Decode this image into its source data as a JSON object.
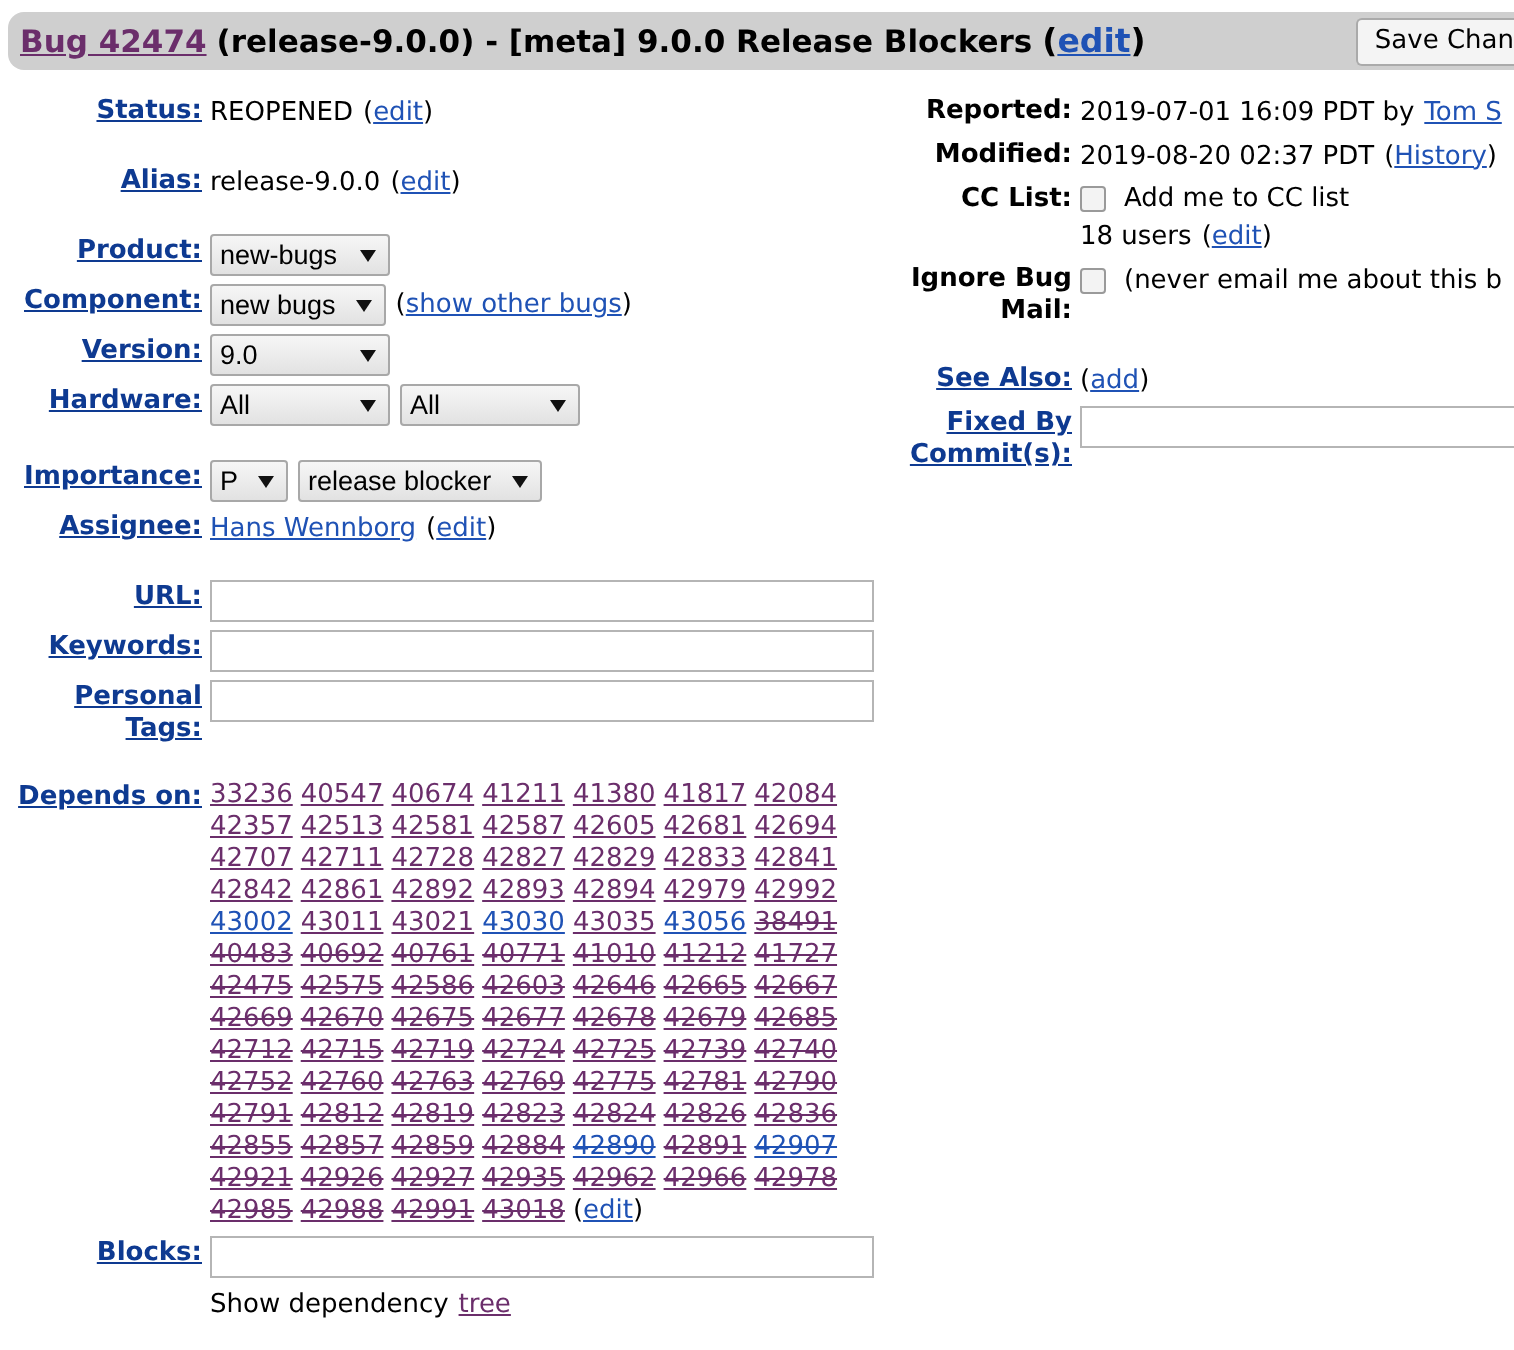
{
  "header": {
    "bug": "Bug 42474",
    "title": "(release-9.0.0) - [meta] 9.0.0 Release Blockers",
    "edit": "(edit)",
    "button": "Save Chan"
  },
  "left": [
    [
      {
        "label": "Status:",
        "label_link": true,
        "items": [
          {
            "kind": "text",
            "text": "REOPENED"
          },
          {
            "kind": "plink",
            "text": "(edit)"
          }
        ]
      }
    ],
    [
      {
        "label": "Alias:",
        "label_link": true,
        "items": [
          {
            "kind": "text",
            "text": "release-9.0.0"
          },
          {
            "kind": "plink",
            "text": "(edit)"
          }
        ]
      }
    ],
    [
      {
        "label": "Product:",
        "label_link": true,
        "items": [
          {
            "kind": "select",
            "text": "new-bugs",
            "wide": true
          }
        ]
      },
      {
        "label": "Component:",
        "label_link": true,
        "items": [
          {
            "kind": "select",
            "text": "new bugs",
            "wide": false
          },
          {
            "kind": "plink",
            "text": "(show other bugs)"
          }
        ]
      },
      {
        "label": "Version:",
        "label_link": true,
        "items": [
          {
            "kind": "select",
            "text": "9.0",
            "wide": true
          }
        ]
      },
      {
        "label": "Hardware:",
        "label_link": true,
        "items": [
          {
            "kind": "select",
            "text": "All",
            "wide": true
          },
          {
            "kind": "select",
            "text": "All",
            "wide": true
          }
        ]
      }
    ],
    [
      {
        "label": "Importance:",
        "label_link": true,
        "items": [
          {
            "kind": "select",
            "text": "P",
            "wide": false
          },
          {
            "kind": "select",
            "text": "release blocker",
            "wide": false
          }
        ]
      },
      {
        "label": "Assignee:",
        "label_link": true,
        "items": [
          {
            "kind": "link",
            "text": "Hans Wennborg"
          },
          {
            "kind": "plink",
            "text": "(edit)"
          }
        ]
      }
    ],
    [
      {
        "label": "URL:",
        "label_link": true,
        "items": [
          {
            "kind": "input"
          }
        ]
      },
      {
        "label": "Keywords:",
        "label_link": true,
        "items": [
          {
            "kind": "input"
          }
        ]
      },
      {
        "label": "Personal Tags:",
        "label_link": true,
        "items": [
          {
            "kind": "input"
          }
        ]
      }
    ],
    [
      {
        "label": "Depends on:",
        "label_link": true,
        "items": [
          {
            "kind": "deps",
            "edit": "(edit)",
            "ids": [
              {
                "id": "33236",
                "visited": true,
                "closed": false
              },
              {
                "id": "40547",
                "visited": true,
                "closed": false
              },
              {
                "id": "40674",
                "visited": true,
                "closed": false
              },
              {
                "id": "41211",
                "visited": true,
                "closed": false
              },
              {
                "id": "41380",
                "visited": true,
                "closed": false
              },
              {
                "id": "41817",
                "visited": true,
                "closed": false
              },
              {
                "id": "42084",
                "visited": true,
                "closed": false
              },
              {
                "id": "42357",
                "visited": true,
                "closed": false
              },
              {
                "id": "42513",
                "visited": true,
                "closed": false
              },
              {
                "id": "42581",
                "visited": true,
                "closed": false
              },
              {
                "id": "42587",
                "visited": true,
                "closed": false
              },
              {
                "id": "42605",
                "visited": true,
                "closed": false
              },
              {
                "id": "42681",
                "visited": true,
                "closed": false
              },
              {
                "id": "42694",
                "visited": true,
                "closed": false
              },
              {
                "id": "42707",
                "visited": true,
                "closed": false
              },
              {
                "id": "42711",
                "visited": true,
                "closed": false
              },
              {
                "id": "42728",
                "visited": true,
                "closed": false
              },
              {
                "id": "42827",
                "visited": true,
                "closed": false
              },
              {
                "id": "42829",
                "visited": true,
                "closed": false
              },
              {
                "id": "42833",
                "visited": true,
                "closed": false
              },
              {
                "id": "42841",
                "visited": true,
                "closed": false
              },
              {
                "id": "42842",
                "visited": true,
                "closed": false
              },
              {
                "id": "42861",
                "visited": true,
                "closed": false
              },
              {
                "id": "42892",
                "visited": true,
                "closed": false
              },
              {
                "id": "42893",
                "visited": true,
                "closed": false
              },
              {
                "id": "42894",
                "visited": true,
                "closed": false
              },
              {
                "id": "42979",
                "visited": true,
                "closed": false
              },
              {
                "id": "42992",
                "visited": true,
                "closed": false
              },
              {
                "id": "43002",
                "visited": false,
                "closed": false
              },
              {
                "id": "43011",
                "visited": true,
                "closed": false
              },
              {
                "id": "43021",
                "visited": true,
                "closed": false
              },
              {
                "id": "43030",
                "visited": false,
                "closed": false
              },
              {
                "id": "43035",
                "visited": true,
                "closed": false
              },
              {
                "id": "43056",
                "visited": false,
                "closed": false
              },
              {
                "id": "38491",
                "visited": true,
                "closed": true
              },
              {
                "id": "40483",
                "visited": true,
                "closed": true
              },
              {
                "id": "40692",
                "visited": true,
                "closed": true
              },
              {
                "id": "40761",
                "visited": true,
                "closed": true
              },
              {
                "id": "40771",
                "visited": true,
                "closed": true
              },
              {
                "id": "41010",
                "visited": true,
                "closed": true
              },
              {
                "id": "41212",
                "visited": true,
                "closed": true
              },
              {
                "id": "41727",
                "visited": true,
                "closed": true
              },
              {
                "id": "42475",
                "visited": true,
                "closed": true
              },
              {
                "id": "42575",
                "visited": true,
                "closed": true
              },
              {
                "id": "42586",
                "visited": true,
                "closed": true
              },
              {
                "id": "42603",
                "visited": true,
                "closed": true
              },
              {
                "id": "42646",
                "visited": true,
                "closed": true
              },
              {
                "id": "42665",
                "visited": true,
                "closed": true
              },
              {
                "id": "42667",
                "visited": true,
                "closed": true
              },
              {
                "id": "42669",
                "visited": true,
                "closed": true
              },
              {
                "id": "42670",
                "visited": true,
                "closed": true
              },
              {
                "id": "42675",
                "visited": true,
                "closed": true
              },
              {
                "id": "42677",
                "visited": true,
                "closed": true
              },
              {
                "id": "42678",
                "visited": true,
                "closed": true
              },
              {
                "id": "42679",
                "visited": true,
                "closed": true
              },
              {
                "id": "42685",
                "visited": true,
                "closed": true
              },
              {
                "id": "42712",
                "visited": true,
                "closed": true
              },
              {
                "id": "42715",
                "visited": true,
                "closed": true
              },
              {
                "id": "42719",
                "visited": true,
                "closed": true
              },
              {
                "id": "42724",
                "visited": true,
                "closed": true
              },
              {
                "id": "42725",
                "visited": true,
                "closed": true
              },
              {
                "id": "42739",
                "visited": true,
                "closed": true
              },
              {
                "id": "42740",
                "visited": true,
                "closed": true
              },
              {
                "id": "42752",
                "visited": true,
                "closed": true
              },
              {
                "id": "42760",
                "visited": true,
                "closed": true
              },
              {
                "id": "42763",
                "visited": true,
                "closed": true
              },
              {
                "id": "42769",
                "visited": true,
                "closed": true
              },
              {
                "id": "42775",
                "visited": true,
                "closed": true
              },
              {
                "id": "42781",
                "visited": true,
                "closed": true
              },
              {
                "id": "42790",
                "visited": true,
                "closed": true
              },
              {
                "id": "42791",
                "visited": true,
                "closed": true
              },
              {
                "id": "42812",
                "visited": true,
                "closed": true
              },
              {
                "id": "42819",
                "visited": true,
                "closed": true
              },
              {
                "id": "42823",
                "visited": true,
                "closed": true
              },
              {
                "id": "42824",
                "visited": true,
                "closed": true
              },
              {
                "id": "42826",
                "visited": true,
                "closed": true
              },
              {
                "id": "42836",
                "visited": true,
                "closed": true
              },
              {
                "id": "42855",
                "visited": true,
                "closed": true
              },
              {
                "id": "42857",
                "visited": true,
                "closed": true
              },
              {
                "id": "42859",
                "visited": true,
                "closed": true
              },
              {
                "id": "42884",
                "visited": true,
                "closed": true
              },
              {
                "id": "42890",
                "visited": false,
                "closed": true
              },
              {
                "id": "42891",
                "visited": true,
                "closed": true
              },
              {
                "id": "42907",
                "visited": false,
                "closed": true
              },
              {
                "id": "42921",
                "visited": true,
                "closed": true
              },
              {
                "id": "42926",
                "visited": true,
                "closed": true
              },
              {
                "id": "42927",
                "visited": true,
                "closed": true
              },
              {
                "id": "42935",
                "visited": true,
                "closed": true
              },
              {
                "id": "42962",
                "visited": true,
                "closed": true
              },
              {
                "id": "42966",
                "visited": true,
                "closed": true
              },
              {
                "id": "42978",
                "visited": true,
                "closed": true
              },
              {
                "id": "42985",
                "visited": true,
                "closed": true
              },
              {
                "id": "42988",
                "visited": true,
                "closed": true
              },
              {
                "id": "42991",
                "visited": true,
                "closed": true
              },
              {
                "id": "43018",
                "visited": true,
                "closed": true
              }
            ]
          }
        ]
      },
      {
        "label": "Blocks:",
        "label_link": true,
        "items": [
          {
            "kind": "input"
          }
        ]
      },
      {
        "items": [
          {
            "kind": "text",
            "text": "Show dependency"
          },
          {
            "kind": "vlink",
            "text": "tree"
          }
        ]
      }
    ]
  ],
  "right": [
    [
      {
        "label": "Reported:",
        "label_link": false,
        "items": [
          {
            "kind": "text",
            "text": "2019-07-01 16:09 PDT by"
          },
          {
            "kind": "link",
            "text": "Tom S"
          }
        ]
      },
      {
        "label": "Modified:",
        "label_link": false,
        "items": [
          {
            "kind": "text",
            "text": "2019-08-20 02:37 PDT"
          },
          {
            "kind": "plink",
            "text": "(History)"
          }
        ]
      },
      {
        "label": "CC List:",
        "label_link": false,
        "items": [
          {
            "kind": "checkbox",
            "checked": false
          },
          {
            "kind": "text",
            "text": "Add me to CC list"
          },
          {
            "kind": "break"
          },
          {
            "kind": "text",
            "text": "18 users"
          },
          {
            "kind": "plink",
            "text": "(edit)"
          }
        ]
      },
      {
        "label": "Ignore Bug Mail:",
        "label_link": false,
        "items": [
          {
            "kind": "checkbox",
            "checked": false
          },
          {
            "kind": "text",
            "text": "(never email me about this b"
          }
        ]
      }
    ],
    [
      {
        "label": "See Also:",
        "label_link": true,
        "items": [
          {
            "kind": "plink",
            "text": "(add)"
          }
        ]
      },
      {
        "label": "Fixed By Commit(s):",
        "label_link": true,
        "items": [
          {
            "kind": "input"
          }
        ]
      }
    ]
  ]
}
